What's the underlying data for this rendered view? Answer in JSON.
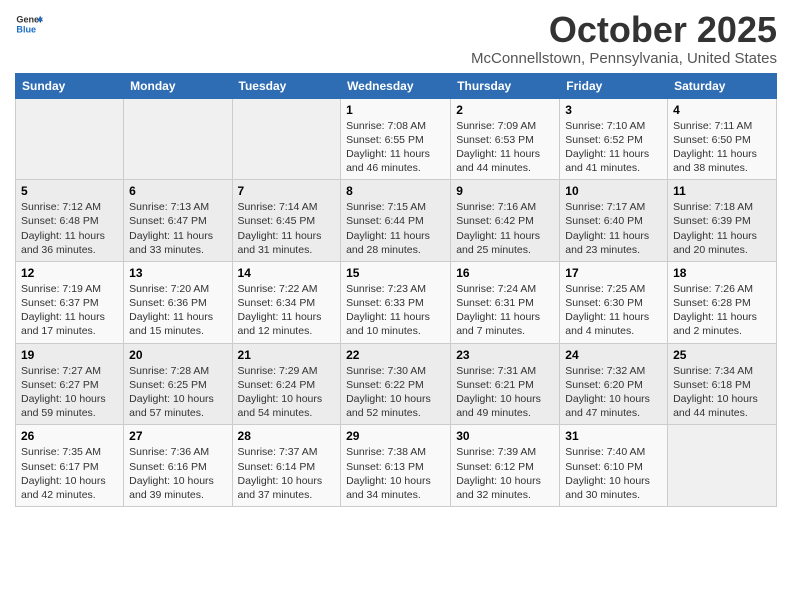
{
  "logo": {
    "general": "General",
    "blue": "Blue"
  },
  "header": {
    "title": "October 2025",
    "subtitle": "McConnellstown, Pennsylvania, United States"
  },
  "days_of_week": [
    "Sunday",
    "Monday",
    "Tuesday",
    "Wednesday",
    "Thursday",
    "Friday",
    "Saturday"
  ],
  "weeks": [
    [
      {
        "day": "",
        "sunrise": "",
        "sunset": "",
        "daylight": ""
      },
      {
        "day": "",
        "sunrise": "",
        "sunset": "",
        "daylight": ""
      },
      {
        "day": "",
        "sunrise": "",
        "sunset": "",
        "daylight": ""
      },
      {
        "day": "1",
        "sunrise": "Sunrise: 7:08 AM",
        "sunset": "Sunset: 6:55 PM",
        "daylight": "Daylight: 11 hours and 46 minutes."
      },
      {
        "day": "2",
        "sunrise": "Sunrise: 7:09 AM",
        "sunset": "Sunset: 6:53 PM",
        "daylight": "Daylight: 11 hours and 44 minutes."
      },
      {
        "day": "3",
        "sunrise": "Sunrise: 7:10 AM",
        "sunset": "Sunset: 6:52 PM",
        "daylight": "Daylight: 11 hours and 41 minutes."
      },
      {
        "day": "4",
        "sunrise": "Sunrise: 7:11 AM",
        "sunset": "Sunset: 6:50 PM",
        "daylight": "Daylight: 11 hours and 38 minutes."
      }
    ],
    [
      {
        "day": "5",
        "sunrise": "Sunrise: 7:12 AM",
        "sunset": "Sunset: 6:48 PM",
        "daylight": "Daylight: 11 hours and 36 minutes."
      },
      {
        "day": "6",
        "sunrise": "Sunrise: 7:13 AM",
        "sunset": "Sunset: 6:47 PM",
        "daylight": "Daylight: 11 hours and 33 minutes."
      },
      {
        "day": "7",
        "sunrise": "Sunrise: 7:14 AM",
        "sunset": "Sunset: 6:45 PM",
        "daylight": "Daylight: 11 hours and 31 minutes."
      },
      {
        "day": "8",
        "sunrise": "Sunrise: 7:15 AM",
        "sunset": "Sunset: 6:44 PM",
        "daylight": "Daylight: 11 hours and 28 minutes."
      },
      {
        "day": "9",
        "sunrise": "Sunrise: 7:16 AM",
        "sunset": "Sunset: 6:42 PM",
        "daylight": "Daylight: 11 hours and 25 minutes."
      },
      {
        "day": "10",
        "sunrise": "Sunrise: 7:17 AM",
        "sunset": "Sunset: 6:40 PM",
        "daylight": "Daylight: 11 hours and 23 minutes."
      },
      {
        "day": "11",
        "sunrise": "Sunrise: 7:18 AM",
        "sunset": "Sunset: 6:39 PM",
        "daylight": "Daylight: 11 hours and 20 minutes."
      }
    ],
    [
      {
        "day": "12",
        "sunrise": "Sunrise: 7:19 AM",
        "sunset": "Sunset: 6:37 PM",
        "daylight": "Daylight: 11 hours and 17 minutes."
      },
      {
        "day": "13",
        "sunrise": "Sunrise: 7:20 AM",
        "sunset": "Sunset: 6:36 PM",
        "daylight": "Daylight: 11 hours and 15 minutes."
      },
      {
        "day": "14",
        "sunrise": "Sunrise: 7:22 AM",
        "sunset": "Sunset: 6:34 PM",
        "daylight": "Daylight: 11 hours and 12 minutes."
      },
      {
        "day": "15",
        "sunrise": "Sunrise: 7:23 AM",
        "sunset": "Sunset: 6:33 PM",
        "daylight": "Daylight: 11 hours and 10 minutes."
      },
      {
        "day": "16",
        "sunrise": "Sunrise: 7:24 AM",
        "sunset": "Sunset: 6:31 PM",
        "daylight": "Daylight: 11 hours and 7 minutes."
      },
      {
        "day": "17",
        "sunrise": "Sunrise: 7:25 AM",
        "sunset": "Sunset: 6:30 PM",
        "daylight": "Daylight: 11 hours and 4 minutes."
      },
      {
        "day": "18",
        "sunrise": "Sunrise: 7:26 AM",
        "sunset": "Sunset: 6:28 PM",
        "daylight": "Daylight: 11 hours and 2 minutes."
      }
    ],
    [
      {
        "day": "19",
        "sunrise": "Sunrise: 7:27 AM",
        "sunset": "Sunset: 6:27 PM",
        "daylight": "Daylight: 10 hours and 59 minutes."
      },
      {
        "day": "20",
        "sunrise": "Sunrise: 7:28 AM",
        "sunset": "Sunset: 6:25 PM",
        "daylight": "Daylight: 10 hours and 57 minutes."
      },
      {
        "day": "21",
        "sunrise": "Sunrise: 7:29 AM",
        "sunset": "Sunset: 6:24 PM",
        "daylight": "Daylight: 10 hours and 54 minutes."
      },
      {
        "day": "22",
        "sunrise": "Sunrise: 7:30 AM",
        "sunset": "Sunset: 6:22 PM",
        "daylight": "Daylight: 10 hours and 52 minutes."
      },
      {
        "day": "23",
        "sunrise": "Sunrise: 7:31 AM",
        "sunset": "Sunset: 6:21 PM",
        "daylight": "Daylight: 10 hours and 49 minutes."
      },
      {
        "day": "24",
        "sunrise": "Sunrise: 7:32 AM",
        "sunset": "Sunset: 6:20 PM",
        "daylight": "Daylight: 10 hours and 47 minutes."
      },
      {
        "day": "25",
        "sunrise": "Sunrise: 7:34 AM",
        "sunset": "Sunset: 6:18 PM",
        "daylight": "Daylight: 10 hours and 44 minutes."
      }
    ],
    [
      {
        "day": "26",
        "sunrise": "Sunrise: 7:35 AM",
        "sunset": "Sunset: 6:17 PM",
        "daylight": "Daylight: 10 hours and 42 minutes."
      },
      {
        "day": "27",
        "sunrise": "Sunrise: 7:36 AM",
        "sunset": "Sunset: 6:16 PM",
        "daylight": "Daylight: 10 hours and 39 minutes."
      },
      {
        "day": "28",
        "sunrise": "Sunrise: 7:37 AM",
        "sunset": "Sunset: 6:14 PM",
        "daylight": "Daylight: 10 hours and 37 minutes."
      },
      {
        "day": "29",
        "sunrise": "Sunrise: 7:38 AM",
        "sunset": "Sunset: 6:13 PM",
        "daylight": "Daylight: 10 hours and 34 minutes."
      },
      {
        "day": "30",
        "sunrise": "Sunrise: 7:39 AM",
        "sunset": "Sunset: 6:12 PM",
        "daylight": "Daylight: 10 hours and 32 minutes."
      },
      {
        "day": "31",
        "sunrise": "Sunrise: 7:40 AM",
        "sunset": "Sunset: 6:10 PM",
        "daylight": "Daylight: 10 hours and 30 minutes."
      },
      {
        "day": "",
        "sunrise": "",
        "sunset": "",
        "daylight": ""
      }
    ]
  ]
}
